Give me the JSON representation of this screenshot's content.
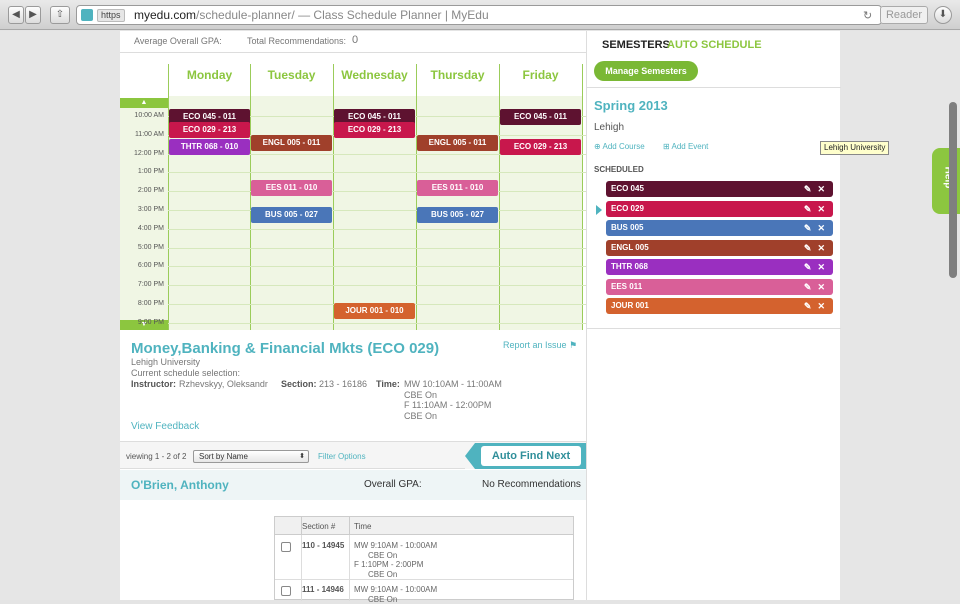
{
  "browser": {
    "url_scheme": "https",
    "url_host": "myedu.com",
    "url_path": "/schedule-planner/",
    "page_title": " — Class Schedule Planner | MyEdu",
    "reader_label": "Reader"
  },
  "stats": {
    "gpa_label": "Average Overall GPA:",
    "recs_label": "Total Recommendations:",
    "recs_value": "0"
  },
  "calendar": {
    "days": [
      "Monday",
      "Tuesday",
      "Wednesday",
      "Thursday",
      "Friday"
    ],
    "times": [
      "10:00 AM",
      "11:00 AM",
      "12:00 PM",
      "1:00 PM",
      "2:00 PM",
      "3:00 PM",
      "4:00 PM",
      "5:00 PM",
      "6:00 PM",
      "7:00 PM",
      "8:00 PM",
      "9:00 PM"
    ],
    "events": [
      {
        "label": "ECO 045 - 011",
        "day": 0,
        "start": 10.0,
        "color": "#5e1230"
      },
      {
        "label": "ECO 029 - 213",
        "day": 0,
        "start": 10.7,
        "color": "#c8174c"
      },
      {
        "label": "THTR 068 - 010",
        "day": 0,
        "start": 11.6,
        "color": "#9a2fc0"
      },
      {
        "label": "ENGL 005 - 011",
        "day": 1,
        "start": 11.4,
        "color": "#a0402b"
      },
      {
        "label": "EES 011 - 010",
        "day": 1,
        "start": 13.8,
        "color": "#d95f98"
      },
      {
        "label": "BUS 005 - 027",
        "day": 1,
        "start": 15.2,
        "color": "#4a76b8"
      },
      {
        "label": "ECO 045 - 011",
        "day": 2,
        "start": 10.0,
        "color": "#5e1230"
      },
      {
        "label": "ECO 029 - 213",
        "day": 2,
        "start": 10.7,
        "color": "#c8174c"
      },
      {
        "label": "JOUR 001 - 010",
        "day": 2,
        "start": 20.3,
        "color": "#d4622e"
      },
      {
        "label": "ENGL 005 - 011",
        "day": 3,
        "start": 11.4,
        "color": "#a0402b"
      },
      {
        "label": "EES 011 - 010",
        "day": 3,
        "start": 13.8,
        "color": "#d95f98"
      },
      {
        "label": "BUS 005 - 027",
        "day": 3,
        "start": 15.2,
        "color": "#4a76b8"
      },
      {
        "label": "ECO 045 - 011",
        "day": 4,
        "start": 10.0,
        "color": "#5e1230"
      },
      {
        "label": "ECO 029 - 213",
        "day": 4,
        "start": 11.6,
        "color": "#c8174c"
      }
    ]
  },
  "course": {
    "title": "Money,Banking & Financial Mkts (ECO 029)",
    "report_label": "Report an Issue",
    "university": "Lehigh University",
    "selection_label": "Current schedule selection:",
    "instructor_label": "Instructor:",
    "instructor": "Rzhevskyy, Oleksandr",
    "section_label": "Section:",
    "section": "213 - 16186",
    "time_label": "Time:",
    "time_lines": [
      "MW 10:10AM - 11:00AM",
      "CBE On",
      "F 11:10AM - 12:00PM",
      "CBE On"
    ],
    "feedback_label": "View Feedback"
  },
  "filter": {
    "viewing": "viewing 1 - 2 of 2",
    "sort": "Sort by Name",
    "filter_options": "Filter Options",
    "auto_find": "Auto Find Next"
  },
  "instructor_row": {
    "name": "O'Brien, Anthony",
    "gpa_label": "Overall GPA:",
    "recs": "No Recommendations"
  },
  "sections": {
    "headers": [
      "Section #",
      "Time"
    ],
    "rows": [
      {
        "section": "110 - 14945",
        "lines": [
          "MW 9:10AM - 10:00AM",
          "CBE On",
          "F 1:10PM - 2:00PM",
          "CBE On"
        ]
      },
      {
        "section": "111 - 14946",
        "lines": [
          "MW 9:10AM - 10:00AM",
          "CBE On"
        ]
      }
    ]
  },
  "panel": {
    "tab_semesters": "SEMESTERS",
    "tab_auto": "AUTO SCHEDULE",
    "manage": "Manage Semesters",
    "semester": "Spring 2013",
    "university": "Lehigh",
    "add_course": "Add Course",
    "add_event": "Add Event",
    "scheduled_label": "SCHEDULED",
    "courses": [
      {
        "name": "ECO 045",
        "color": "#5e1230"
      },
      {
        "name": "ECO 029",
        "color": "#c8174c"
      },
      {
        "name": "BUS 005",
        "color": "#4a76b8"
      },
      {
        "name": "ENGL 005",
        "color": "#a0402b"
      },
      {
        "name": "THTR 068",
        "color": "#9a2fc0"
      },
      {
        "name": "EES 011",
        "color": "#d95f98"
      },
      {
        "name": "JOUR 001",
        "color": "#d4622e"
      }
    ],
    "pill_icons": [
      "pencil-icon",
      "close-icon"
    ]
  },
  "tooltip": "Lehigh University",
  "help": "Help"
}
